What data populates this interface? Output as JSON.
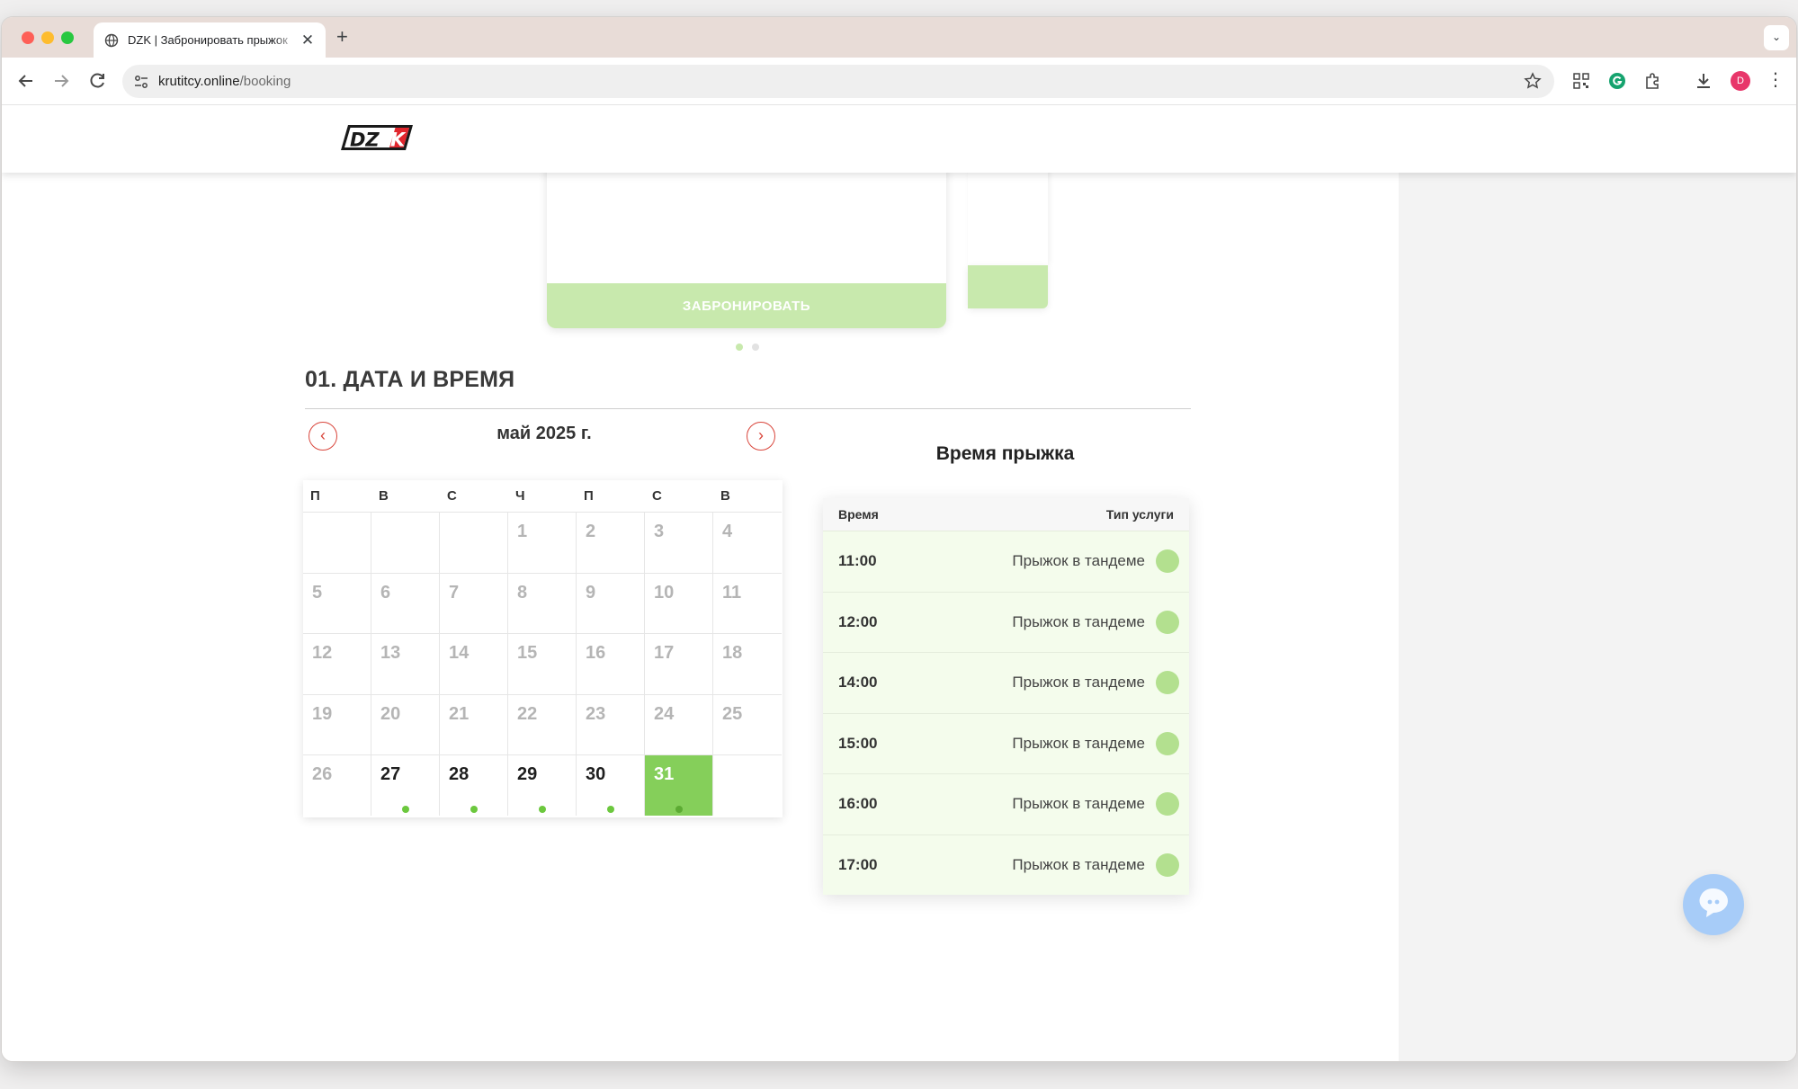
{
  "browser": {
    "tab_title": "DZK | Забронировать прыжок",
    "tab_close": "✕",
    "new_tab": "+",
    "tab_menu": "⌄",
    "url_host": "krutitcy.online",
    "url_path": "/booking",
    "profile_initial": "D"
  },
  "card": {
    "button_label": "ЗАБРОНИРОВАТЬ"
  },
  "section": {
    "title": "01. ДАТА И ВРЕМЯ"
  },
  "calendar": {
    "month_label": "май 2025 г.",
    "prev": "‹",
    "next": "›",
    "weekdays": [
      "П",
      "В",
      "С",
      "Ч",
      "П",
      "С",
      "В"
    ],
    "days": [
      "",
      "",
      "",
      "1",
      "2",
      "3",
      "4",
      "5",
      "6",
      "7",
      "8",
      "9",
      "10",
      "11",
      "12",
      "13",
      "14",
      "15",
      "16",
      "17",
      "18",
      "19",
      "20",
      "21",
      "22",
      "23",
      "24",
      "25",
      "26",
      "27",
      "28",
      "29",
      "30",
      "31",
      ""
    ],
    "available": [
      "27",
      "28",
      "29",
      "30",
      "31"
    ],
    "selected": "31"
  },
  "slots": {
    "title": "Время прыжка",
    "col_time": "Время",
    "col_type": "Тип услуги",
    "rows": [
      {
        "time": "11:00",
        "type": "Прыжок в тандеме"
      },
      {
        "time": "12:00",
        "type": "Прыжок в тандеме"
      },
      {
        "time": "14:00",
        "type": "Прыжок в тандеме"
      },
      {
        "time": "15:00",
        "type": "Прыжок в тандеме"
      },
      {
        "time": "16:00",
        "type": "Прыжок в тандеме"
      },
      {
        "time": "17:00",
        "type": "Прыжок в тандеме"
      }
    ]
  },
  "colors": {
    "accent_green": "#85cf5a",
    "button_green": "#c8e9ad",
    "nav_red": "#d9453b",
    "chat_blue": "#a7ccf8"
  }
}
